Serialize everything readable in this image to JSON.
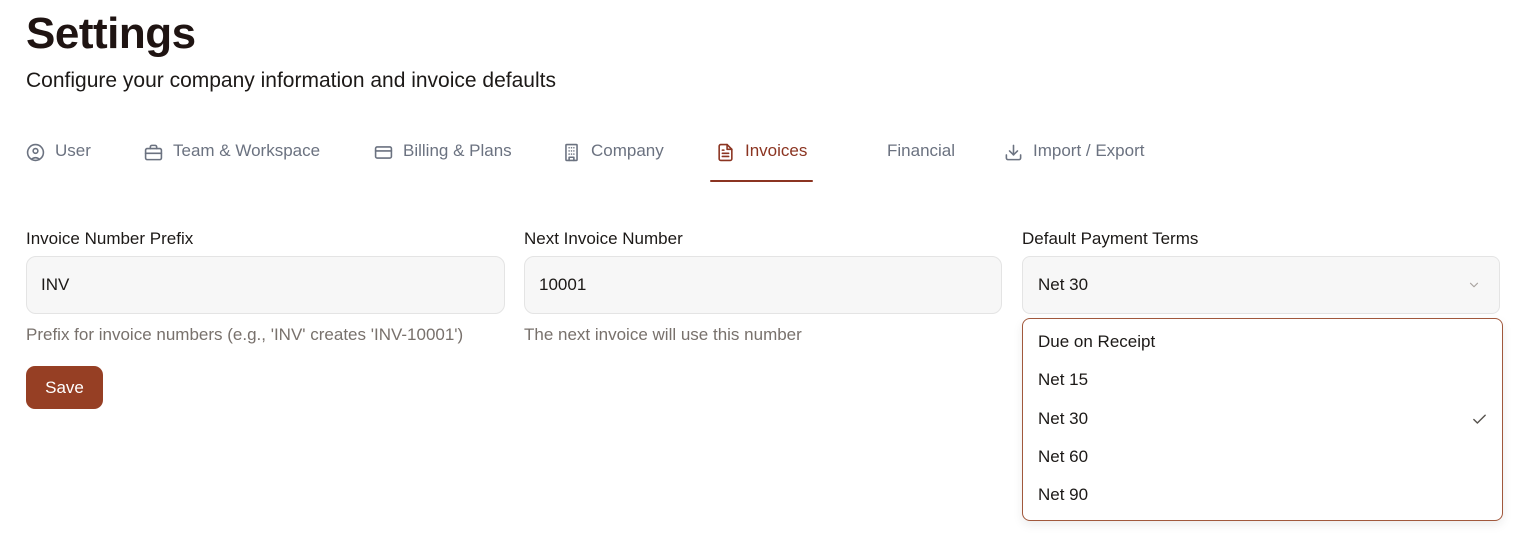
{
  "header": {
    "title": "Settings",
    "subtitle": "Configure your company information and invoice defaults"
  },
  "tabs": [
    {
      "label": "User",
      "icon": "user-circle-icon"
    },
    {
      "label": "Team & Workspace",
      "icon": "briefcase-icon"
    },
    {
      "label": "Billing & Plans",
      "icon": "credit-card-icon"
    },
    {
      "label": "Company",
      "icon": "building-icon"
    },
    {
      "label": "Invoices",
      "icon": "document-icon",
      "active": true
    },
    {
      "label": "Financial",
      "icon": ""
    },
    {
      "label": "Import / Export",
      "icon": "download-icon"
    }
  ],
  "form": {
    "prefix": {
      "label": "Invoice Number Prefix",
      "value": "INV",
      "help": "Prefix for invoice numbers (e.g., 'INV' creates 'INV-10001')"
    },
    "next_number": {
      "label": "Next Invoice Number",
      "value": "10001",
      "help": "The next invoice will use this number"
    },
    "payment_terms": {
      "label": "Default Payment Terms",
      "selected": "Net 30",
      "options": [
        "Due on Receipt",
        "Net 15",
        "Net 30",
        "Net 60",
        "Net 90"
      ]
    },
    "save_label": "Save"
  },
  "colors": {
    "accent": "#8b3421",
    "button": "#963f24",
    "dropdown_border": "#a1583c",
    "muted_text": "#78716c"
  }
}
